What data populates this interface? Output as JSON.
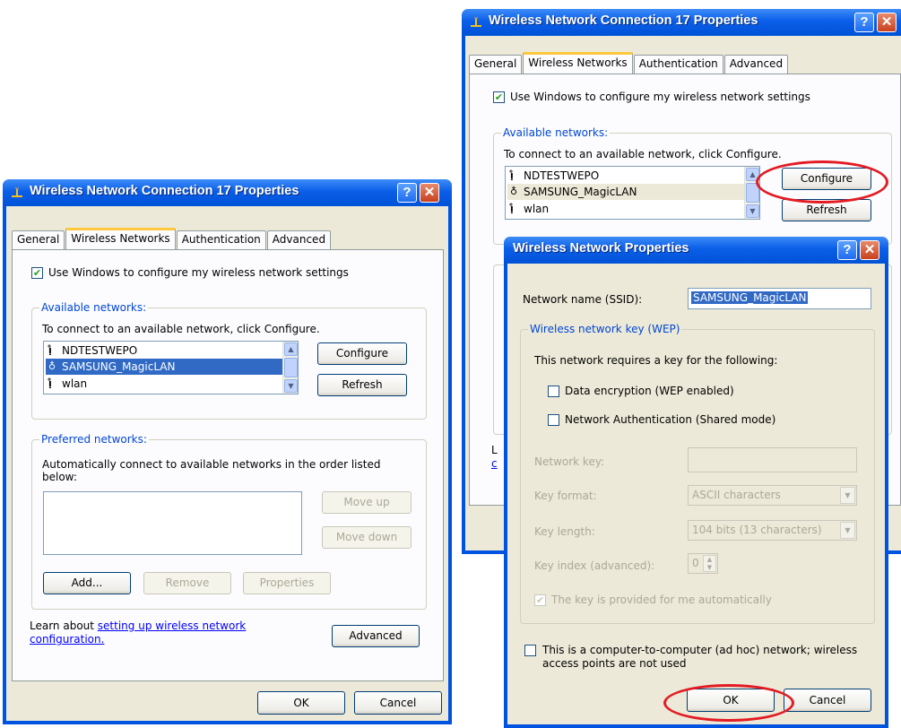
{
  "window_title": "Wireless Network Connection 17 Properties",
  "title_buttons": {
    "help": "?",
    "close": "✕"
  },
  "tabs": [
    "General",
    "Wireless Networks",
    "Authentication",
    "Advanced"
  ],
  "use_windows_label": "Use Windows to configure my wireless network settings",
  "available": {
    "legend": "Available networks:",
    "instruction": "To connect to an available network, click Configure.",
    "networks": [
      {
        "name": "NDTESTWEPO",
        "icon": "antenna-icon"
      },
      {
        "name": "SAMSUNG_MagicLAN",
        "icon": "adhoc-icon"
      },
      {
        "name": "wlan",
        "icon": "antenna-icon"
      }
    ],
    "selected": "SAMSUNG_MagicLAN",
    "configure_button": "Configure",
    "refresh_button": "Refresh"
  },
  "preferred": {
    "legend": "Preferred networks:",
    "description_line1": "Automatically connect to available networks in the order listed",
    "description_line2": "below:",
    "move_up": "Move up",
    "move_down": "Move down",
    "add": "Add...",
    "remove": "Remove",
    "properties": "Properties"
  },
  "learn_prefix": "Learn about ",
  "learn_link_line1": "setting up wireless network",
  "learn_link_line2": "configuration.",
  "advanced_button": "Advanced",
  "ok_button": "OK",
  "cancel_button": "Cancel",
  "partial_text": {
    "l": "L",
    "c": "c"
  },
  "wnp": {
    "title": "Wireless Network Properties",
    "ssid_label": "Network name (SSID):",
    "ssid_value": "SAMSUNG_MagicLAN",
    "wep_legend": "Wireless network key (WEP)",
    "requires_text": "This network requires a key for the following:",
    "data_encryption": "Data encryption (WEP enabled)",
    "network_auth": "Network Authentication (Shared mode)",
    "network_key_label": "Network key:",
    "key_format_label": "Key format:",
    "key_format_value": "ASCII characters",
    "key_length_label": "Key length:",
    "key_length_value": "104 bits (13 characters)",
    "key_index_label": "Key index (advanced):",
    "key_index_value": "0",
    "auto_key": "The key is provided for me automatically",
    "adhoc_line1": "This is a computer-to-computer (ad hoc) network; wireless",
    "adhoc_line2": "access points are not used",
    "ok": "OK",
    "cancel": "Cancel"
  },
  "colors": {
    "title_blue": "#0053e1",
    "dialog_bg": "#ece9d8",
    "tab_accent": "#ffc83c",
    "highlight_ellipse": "#e31b23",
    "selection": "#316ac5"
  }
}
